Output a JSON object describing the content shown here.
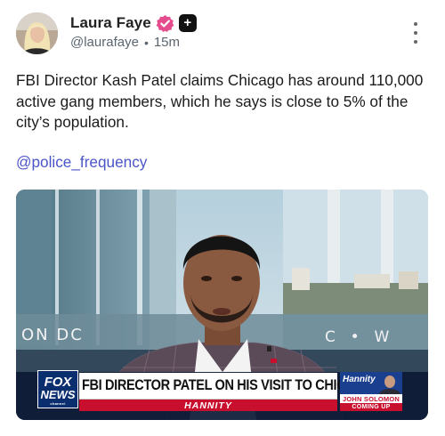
{
  "author": {
    "display_name": "Laura Faye",
    "handle": "@laurafaye",
    "separator": "•",
    "time_ago": "15m"
  },
  "post": {
    "text": "FBI Director Kash Patel claims Chicago has around 110,000 active gang members, which he says is close to 5% of the city’s population.",
    "mention": "@police_frequency"
  },
  "media": {
    "backdrop_left_text": "ON DC",
    "backdrop_right_text": "C  •  W",
    "network_logo": {
      "line1": "FOX",
      "line2": "NEWS",
      "line3": "channel"
    },
    "chyron_headline": "FBI DIRECTOR PATEL ON HIS VISIT TO CHICAGO",
    "show_name": "HANNITY",
    "promo": {
      "show": "Hannity",
      "guest": "JOHN SOLOMON",
      "status": "COMING UP"
    }
  },
  "colors": {
    "verified_badge": "#e44c8e",
    "mention_link": "#4b55c8",
    "fox_blue": "#0b2e6e",
    "fox_red": "#c8102e"
  },
  "icons": [
    "verified-badge-icon",
    "plus-icon",
    "more-options-icon"
  ]
}
